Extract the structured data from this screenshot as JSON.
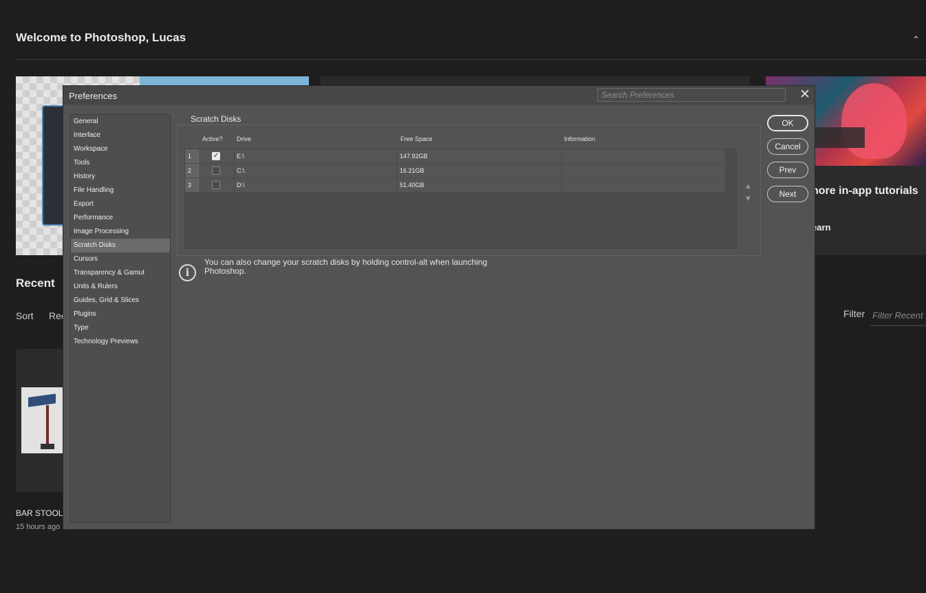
{
  "home": {
    "welcome": "Welcome to Photoshop, Lucas",
    "tutorial_title": "nore in-app tutorials",
    "tutorial_link": "earn",
    "recent_heading": "Recent",
    "sort_label": "Sort",
    "sort_value": "Rec",
    "filter_label": "Filter",
    "filter_placeholder": "Filter Recent F",
    "recent_file": {
      "name": "BAR STOOL",
      "time": "15 hours ago"
    }
  },
  "dialog": {
    "title": "Preferences",
    "search_placeholder": "Search Preferences",
    "nav": [
      "General",
      "Interface",
      "Workspace",
      "Tools",
      "History",
      "File Handling",
      "Export",
      "Performance",
      "Image Processing",
      "Scratch Disks",
      "Cursors",
      "Transparency & Gamut",
      "Units & Rulers",
      "Guides, Grid & Slices",
      "Plugins",
      "Type",
      "Technology Previews"
    ],
    "selected_nav": "Scratch Disks",
    "section_title": "Scratch Disks",
    "columns": {
      "active": "Active?",
      "drive": "Drive",
      "free": "Free Space",
      "info": "Information"
    },
    "disks": [
      {
        "num": "1",
        "active": true,
        "drive": "E:\\",
        "free": "147.92GB",
        "info": ""
      },
      {
        "num": "2",
        "active": false,
        "drive": "C:\\",
        "free": "16.21GB",
        "info": ""
      },
      {
        "num": "3",
        "active": false,
        "drive": "D:\\",
        "free": "51.40GB",
        "info": ""
      }
    ],
    "buttons": {
      "ok": "OK",
      "cancel": "Cancel",
      "prev": "Prev",
      "next": "Next"
    },
    "info_note": "You can also change your scratch disks by holding control-alt when launching Photoshop."
  },
  "icons": {
    "close": "close-icon",
    "info": "info-icon",
    "up": "move-up-icon",
    "down": "move-down-icon",
    "collapse": "chevron-up-icon"
  }
}
